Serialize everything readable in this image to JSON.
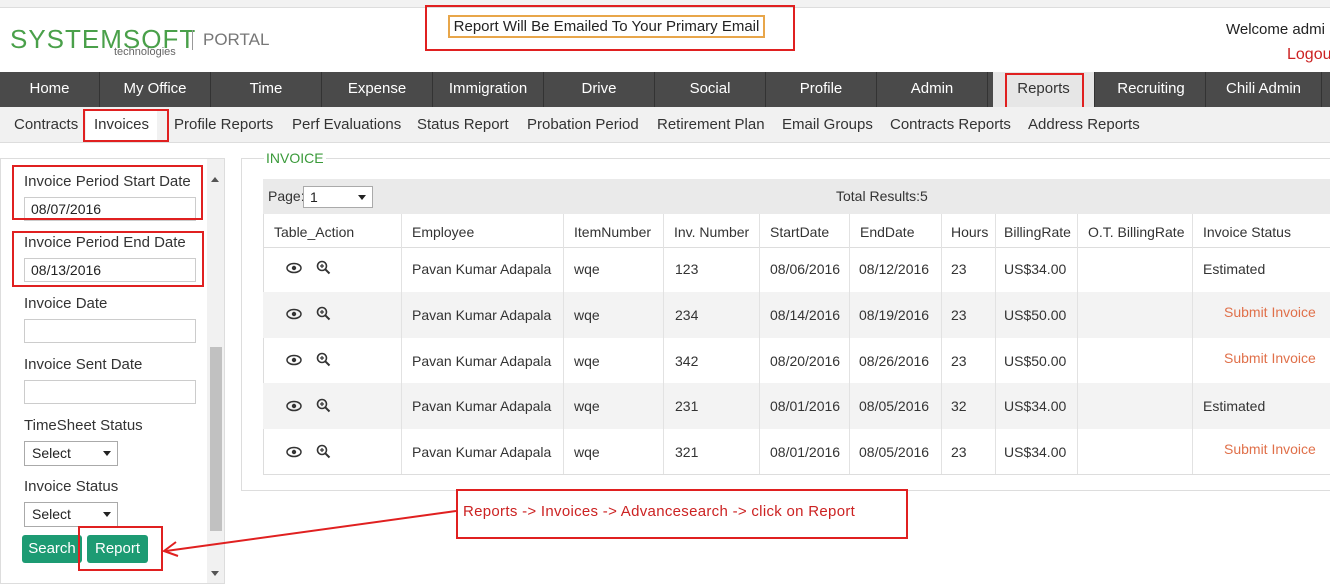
{
  "header": {
    "logo": "SYSTEMSOFT",
    "logo_sub": "technologies",
    "portal": "PORTAL",
    "email_message": "Report Will Be Emailed To Your Primary Email",
    "welcome": "Welcome admi",
    "logout": "Logou"
  },
  "main_nav": [
    "Home",
    "My Office",
    "Time",
    "Expense",
    "Immigration",
    "Drive",
    "Social",
    "Profile",
    "Admin",
    "Reports",
    "Recruiting",
    "Chili Admin"
  ],
  "sub_nav": [
    "Contracts",
    "Invoices",
    "Profile Reports",
    "Perf Evaluations",
    "Status Report",
    "Probation Period",
    "Retirement Plan",
    "Email Groups",
    "Contracts Reports",
    "Address Reports"
  ],
  "search_panel": {
    "start_date_label": "Invoice Period Start Date",
    "start_date_value": "08/07/2016",
    "end_date_label": "Invoice Period End Date",
    "end_date_value": "08/13/2016",
    "invoice_date_label": "Invoice Date",
    "invoice_date_value": "",
    "sent_date_label": "Invoice Sent Date",
    "sent_date_value": "",
    "timesheet_status_label": "TimeSheet Status",
    "timesheet_status_value": "Select",
    "invoice_status_label": "Invoice Status",
    "invoice_status_value": "Select",
    "search_button": "Search",
    "report_button": "Report"
  },
  "invoice": {
    "legend": "INVOICE",
    "page_label": "Page:",
    "page_value": "1",
    "total_results": "Total Results:5",
    "columns": [
      "Table_Action",
      "Employee",
      "ItemNumber",
      "Inv. Number",
      "StartDate",
      "EndDate",
      "Hours",
      "BillingRate",
      "O.T. BillingRate",
      "Invoice Status"
    ],
    "rows": [
      {
        "employee": "Pavan Kumar Adapala",
        "item": "wqe",
        "inv": "123",
        "start": "08/06/2016",
        "end": "08/12/2016",
        "hours": "23",
        "rate": "US$34.00",
        "ot": "",
        "status": "Estimated",
        "link": ""
      },
      {
        "employee": "Pavan Kumar Adapala",
        "item": "wqe",
        "inv": "234",
        "start": "08/14/2016",
        "end": "08/19/2016",
        "hours": "23",
        "rate": "US$50.00",
        "ot": "",
        "status": "",
        "link": "Submit Invoice"
      },
      {
        "employee": "Pavan Kumar Adapala",
        "item": "wqe",
        "inv": "342",
        "start": "08/20/2016",
        "end": "08/26/2016",
        "hours": "23",
        "rate": "US$50.00",
        "ot": "",
        "status": "",
        "link": "Submit Invoice"
      },
      {
        "employee": "Pavan Kumar Adapala",
        "item": "wqe",
        "inv": "231",
        "start": "08/01/2016",
        "end": "08/05/2016",
        "hours": "32",
        "rate": "US$34.00",
        "ot": "",
        "status": "Estimated",
        "link": ""
      },
      {
        "employee": "Pavan Kumar Adapala",
        "item": "wqe",
        "inv": "321",
        "start": "08/01/2016",
        "end": "08/05/2016",
        "hours": "23",
        "rate": "US$34.00",
        "ot": "",
        "status": "",
        "link": "Submit Invoice"
      }
    ]
  },
  "annotation": "Reports -> Invoices -> Advancesearch -> click on Report",
  "colors": {
    "accent_green": "#1d9b73",
    "nav_dark": "#4a4a4a",
    "highlight_red": "#e02020",
    "link_orange": "#e0704a"
  }
}
